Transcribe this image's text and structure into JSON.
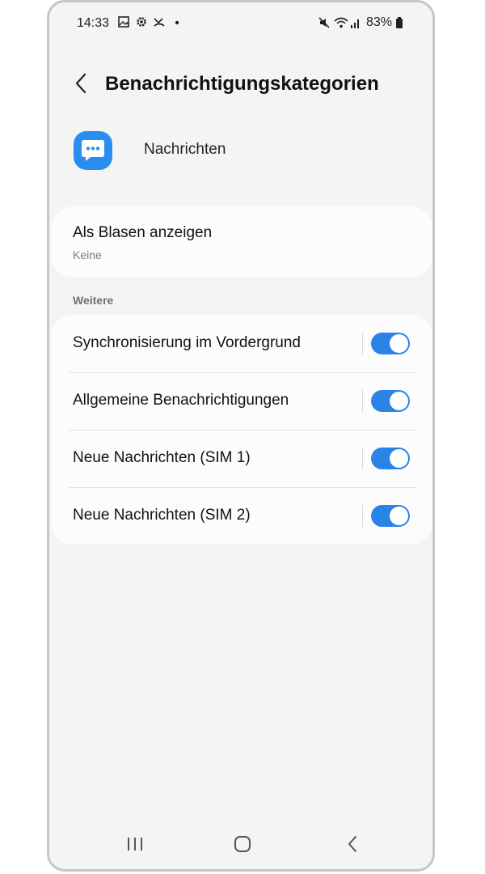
{
  "status_bar": {
    "time": "14:33",
    "left_icons": [
      "gallery-icon",
      "settings-gear-icon",
      "missed-call-icon",
      "dot-icon"
    ],
    "right_icons": [
      "mute-icon",
      "wifi-icon",
      "signal-icon",
      "battery-icon"
    ],
    "battery": "83%"
  },
  "header": {
    "back_icon": "chevron-left-icon",
    "title": "Benachrichtigungskategorien"
  },
  "app": {
    "icon": "chat-bubble-icon",
    "name": "Nachrichten",
    "accent": "#2a8ef0"
  },
  "bubbles": {
    "title": "Als Blasen anzeigen",
    "value": "Keine"
  },
  "section": {
    "label": "Weitere"
  },
  "categories": [
    {
      "label": "Synchronisierung im Vordergrund",
      "enabled": true
    },
    {
      "label": "Allgemeine Benachrichtigungen",
      "enabled": true
    },
    {
      "label": "Neue Nachrichten (SIM 1)",
      "enabled": true
    },
    {
      "label": "Neue Nachrichten (SIM 2)",
      "enabled": true
    }
  ],
  "navbar": {
    "buttons": [
      "recent-apps-icon",
      "home-icon",
      "back-icon"
    ]
  },
  "colors": {
    "background": "#f4f4f4",
    "card": "#fcfcfc",
    "toggle_on": "#2a84e8"
  }
}
